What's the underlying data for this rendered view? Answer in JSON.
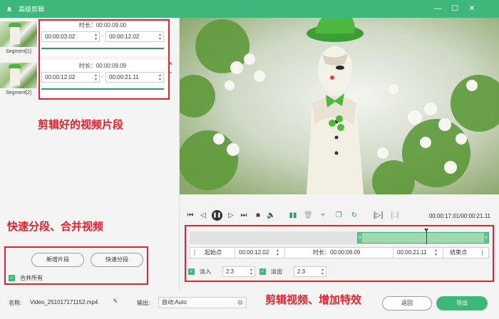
{
  "window": {
    "title": "高级剪辑",
    "minimize_symbol": "—",
    "maximize_symbol": "☐",
    "close_symbol": "✕"
  },
  "segments": [
    {
      "label": "Segment[1]",
      "duration": "时长：00:00:09.00",
      "start": "00:00:03.02",
      "end": "00:00:12.02"
    },
    {
      "label": "Segment[2]",
      "duration": "时长：00:00:09.09",
      "start": "00:00:12.02",
      "end": "00:00:21.11"
    }
  ],
  "annotations": {
    "segments_note": "剪辑好的视频片段",
    "split_note": "快速分段、合并视频",
    "effects_note": "剪辑视频、增加特效"
  },
  "left_actions": {
    "new_segment": "新增片段",
    "quick_split": "快速分段",
    "merge_all": "合并所有",
    "merge_all_checked": true
  },
  "player": {
    "time_readout": "00:00:17.01/00:00:21.11",
    "progress_fraction": 0.79
  },
  "timeline": {
    "selection_start_fraction": 0.56,
    "selection_end_fraction": 1.0,
    "playhead_fraction": 0.79
  },
  "trim": {
    "start_button": "起始点",
    "start_value": "00:00:12.02",
    "duration_label": "时长：00:00:09.09",
    "end_value": "00:00:21.11",
    "end_button": "结束点",
    "left_bracket": "[",
    "right_bracket": "]"
  },
  "fade": {
    "fade_in_label": "淡入",
    "fade_in_value": "2.3",
    "fade_in_checked": true,
    "fade_out_label": "淡出",
    "fade_out_value": "2.3",
    "fade_out_checked": true
  },
  "bottom": {
    "name_label": "名称:",
    "name_value": "Video_251017171152.mp4",
    "output_label": "输出:",
    "output_value": "自动;Auto",
    "back_button": "返回",
    "export_button": "导出"
  },
  "colors": {
    "accent": "#3db87a",
    "annotation": "#e8202a"
  }
}
